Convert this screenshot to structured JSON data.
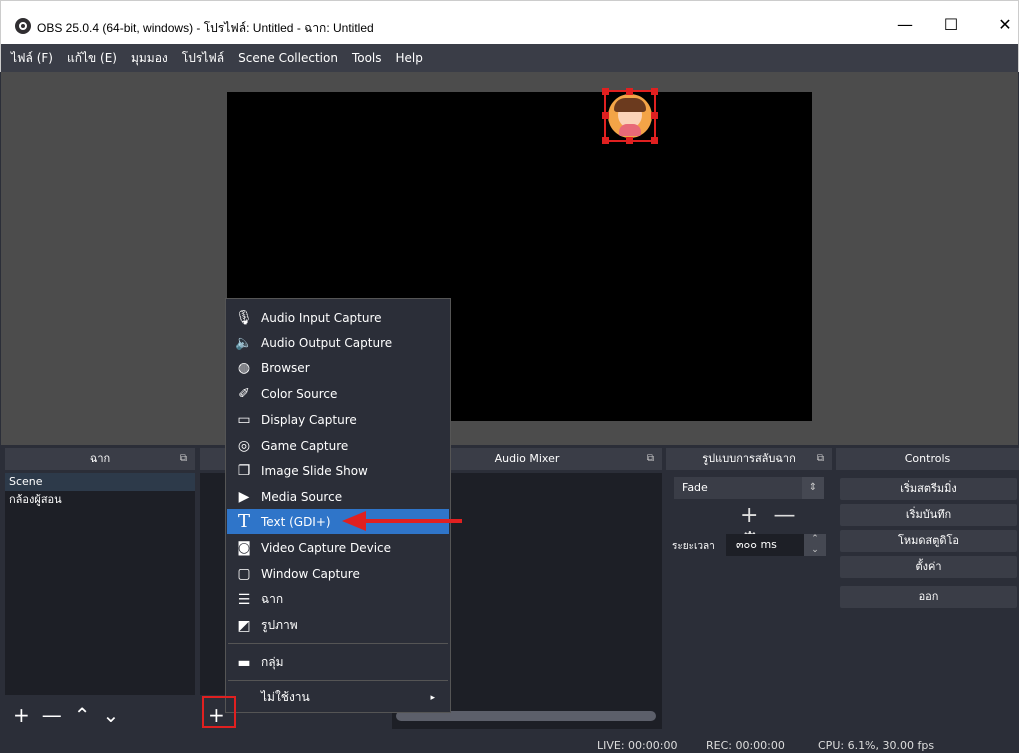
{
  "window": {
    "title": "OBS 25.0.4 (64-bit, windows) - โปรไฟล์: Untitled - ฉาก: Untitled",
    "minimize_glyph": "—",
    "maximize_glyph": "☐",
    "close_glyph": "✕"
  },
  "menu": [
    "ไฟล์ (F)",
    "แก้ไข (E)",
    "มุมมอง",
    "โปรไฟล์",
    "Scene Collection",
    "Tools",
    "Help"
  ],
  "docks": {
    "scenes": {
      "title": "ฉาก",
      "items": [
        "Scene",
        "กล้องผู้สอน"
      ],
      "toolbar": [
        "+",
        "—",
        "⌃",
        "⌄"
      ]
    },
    "sources": {
      "title": "",
      "add_button": "+"
    },
    "mixer": {
      "title": "Audio Mixer"
    },
    "transitions": {
      "title": "รูปแบบการสลับฉาก",
      "selected": "Fade",
      "duration_label": "ระยะเวลา",
      "duration_value": "๓๐๐ ms"
    },
    "controls": {
      "title": "Controls",
      "buttons": [
        "เริ่มสตรีมมิ่ง",
        "เริ่มบันทึก",
        "โหมดสตูดิโอ",
        "ตั้งค่า",
        "ออก"
      ]
    }
  },
  "context_menu": {
    "items": [
      {
        "label": "Audio Input Capture",
        "icon": "microphone-icon",
        "glyph": "🎙"
      },
      {
        "label": "Audio Output Capture",
        "icon": "speaker-icon",
        "glyph": "🔈"
      },
      {
        "label": "Browser",
        "icon": "globe-icon",
        "glyph": "◍"
      },
      {
        "label": "Color Source",
        "icon": "brush-icon",
        "glyph": "✐"
      },
      {
        "label": "Display Capture",
        "icon": "monitor-icon",
        "glyph": "▭"
      },
      {
        "label": "Game Capture",
        "icon": "gamepad-icon",
        "glyph": "◎"
      },
      {
        "label": "Image Slide Show",
        "icon": "slideshow-icon",
        "glyph": "❐"
      },
      {
        "label": "Media Source",
        "icon": "play-icon",
        "glyph": "▶"
      },
      {
        "label": "Text (GDI+)",
        "icon": "text-icon",
        "glyph": "T"
      },
      {
        "label": "Video Capture Device",
        "icon": "camera-icon",
        "glyph": "◙"
      },
      {
        "label": "Window Capture",
        "icon": "window-icon",
        "glyph": "▢"
      },
      {
        "label": "ฉาก",
        "icon": "list-icon",
        "glyph": "☰"
      },
      {
        "label": "รูปภาพ",
        "icon": "image-icon",
        "glyph": "◩"
      },
      {
        "label": "กลุ่ม",
        "icon": "folder-icon",
        "glyph": "▬"
      },
      {
        "label": "ไม่ใช้งาน",
        "icon": "",
        "glyph": ""
      }
    ],
    "highlighted": "Text (GDI+)",
    "submenu_glyph": "▸"
  },
  "status": {
    "live": "LIVE: 00:00:00",
    "rec": "REC: 00:00:00",
    "cpu": "CPU: 6.1%, 30.00 fps"
  },
  "colors": {
    "highlight": "#2f75c9",
    "annotation_red": "#e02020",
    "annotation_blue": "#2f75c9"
  }
}
